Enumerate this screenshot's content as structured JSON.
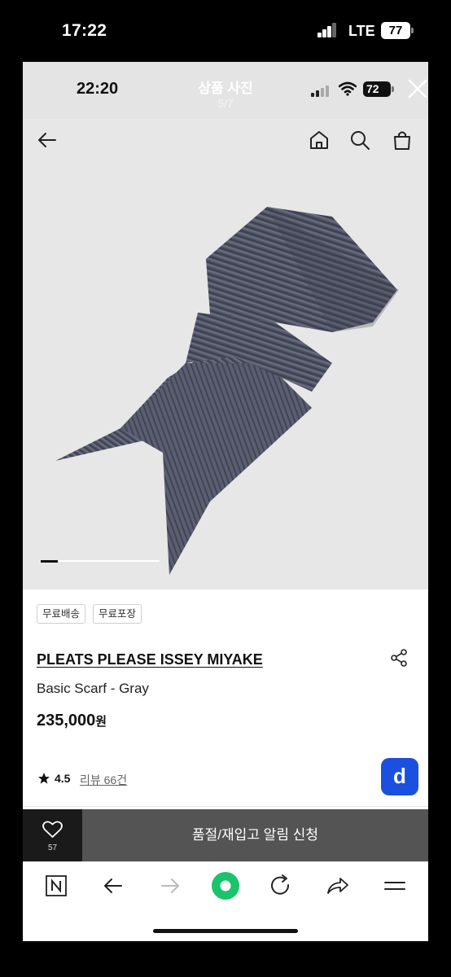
{
  "phone_status": {
    "time": "17:22",
    "network": "LTE",
    "battery": "77"
  },
  "viewer": {
    "time": "22:20",
    "title": "상품 사진",
    "counter": "5/7",
    "battery": "72"
  },
  "image_progress": {
    "current": 1,
    "total": 7
  },
  "product": {
    "tags": [
      "무료배송",
      "무료포장"
    ],
    "brand": "PLEATS PLEASE ISSEY MIYAKE",
    "name": "Basic Scarf - Gray",
    "price": "235,000",
    "price_unit": "원",
    "rating": "4.5",
    "reviews": "리뷰 66건",
    "app_badge": "d"
  },
  "action_bar": {
    "wish_count": "57",
    "restock_label": "품절/재입고 알림 신청"
  },
  "colors": {
    "accent_badge": "#1b4fe0",
    "cta_bg": "#545454",
    "wish_bg": "#1a1a1a",
    "browser_green": "#19c46a"
  }
}
